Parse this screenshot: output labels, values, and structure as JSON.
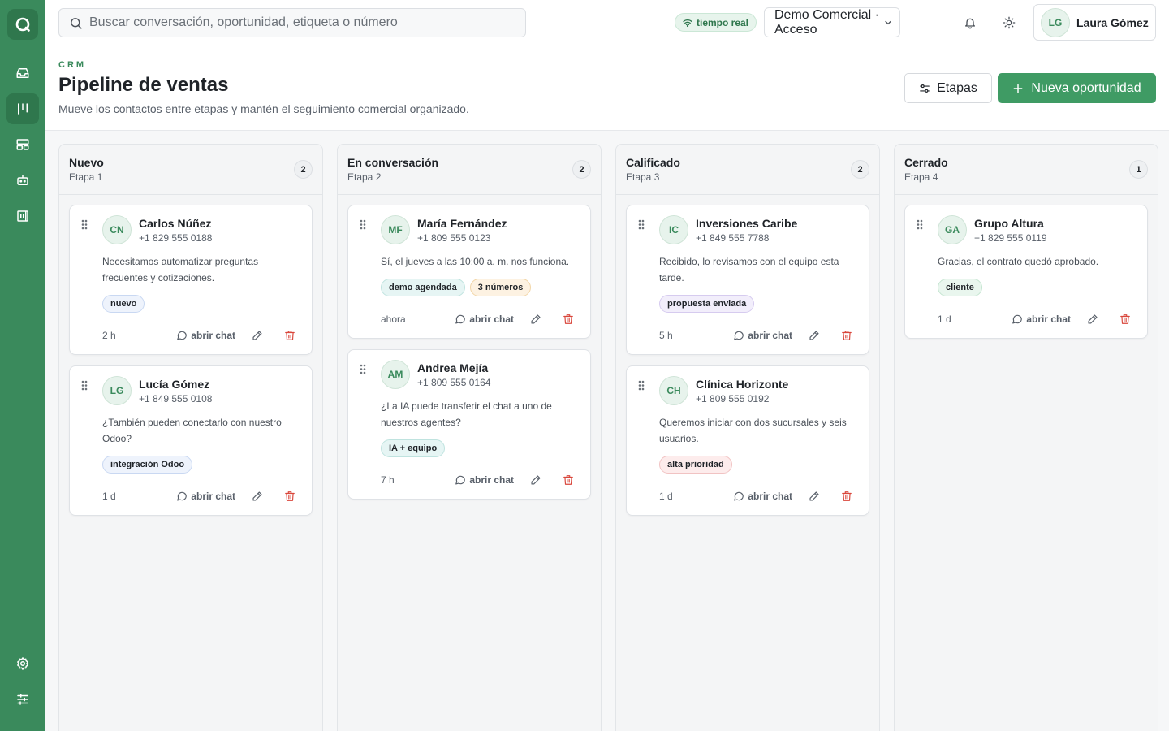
{
  "search": {
    "placeholder": "Buscar conversación, oportunidad, etiqueta o número"
  },
  "realtime_badge": "tiempo real",
  "workspace": "Demo Comercial · Acceso",
  "user": {
    "initials": "LG",
    "name": "Laura Gómez"
  },
  "header": {
    "eyebrow": "CRM",
    "title": "Pipeline de ventas",
    "subtitle": "Mueve los contactos entre etapas y mantén el seguimiento comercial organizado.",
    "stages_button": "Etapas",
    "new_button": "Nueva oportunidad"
  },
  "colors": {
    "accent": "#3a8a5c",
    "primary_button": "#3f9b64",
    "danger": "#d9463b"
  },
  "card_actions": {
    "open_chat": "abrir chat"
  },
  "columns": [
    {
      "title": "Nuevo",
      "stage": "Etapa 1",
      "count": "2",
      "cards": [
        {
          "initials": "CN",
          "name": "Carlos Núñez",
          "phone": "+1 829 555 0188",
          "message": "Necesitamos automatizar preguntas frecuentes y cotizaciones.",
          "tags": [
            {
              "label": "nuevo",
              "tone": "blue"
            }
          ],
          "time": "2 h"
        },
        {
          "initials": "LG",
          "name": "Lucía Gómez",
          "phone": "+1 849 555 0108",
          "message": "¿También pueden conectarlo con nuestro Odoo?",
          "tags": [
            {
              "label": "integración Odoo",
              "tone": "blue"
            }
          ],
          "time": "1 d"
        }
      ]
    },
    {
      "title": "En conversación",
      "stage": "Etapa 2",
      "count": "2",
      "cards": [
        {
          "initials": "MF",
          "name": "María Fernández",
          "phone": "+1 809 555 0123",
          "message": "Sí, el jueves a las 10:00 a. m. nos funciona.",
          "tags": [
            {
              "label": "demo agendada",
              "tone": "teal"
            },
            {
              "label": "3 números",
              "tone": "orange"
            }
          ],
          "time": "ahora"
        },
        {
          "initials": "AM",
          "name": "Andrea Mejía",
          "phone": "+1 809 555 0164",
          "message": "¿La IA puede transferir el chat a uno de nuestros agentes?",
          "tags": [
            {
              "label": "IA + equipo",
              "tone": "teal"
            }
          ],
          "time": "7 h"
        }
      ]
    },
    {
      "title": "Calificado",
      "stage": "Etapa 3",
      "count": "2",
      "cards": [
        {
          "initials": "IC",
          "name": "Inversiones Caribe",
          "phone": "+1 849 555 7788",
          "message": "Recibido, lo revisamos con el equipo esta tarde.",
          "tags": [
            {
              "label": "propuesta enviada",
              "tone": "purple"
            }
          ],
          "time": "5 h"
        },
        {
          "initials": "CH",
          "name": "Clínica Horizonte",
          "phone": "+1 809 555 0192",
          "message": "Queremos iniciar con dos sucursales y seis usuarios.",
          "tags": [
            {
              "label": "alta prioridad",
              "tone": "red"
            }
          ],
          "time": "1 d"
        }
      ]
    },
    {
      "title": "Cerrado",
      "stage": "Etapa 4",
      "count": "1",
      "cards": [
        {
          "initials": "GA",
          "name": "Grupo Altura",
          "phone": "+1 829 555 0119",
          "message": "Gracias, el contrato quedó aprobado.",
          "tags": [
            {
              "label": "cliente",
              "tone": "green"
            }
          ],
          "time": "1 d"
        }
      ]
    }
  ]
}
